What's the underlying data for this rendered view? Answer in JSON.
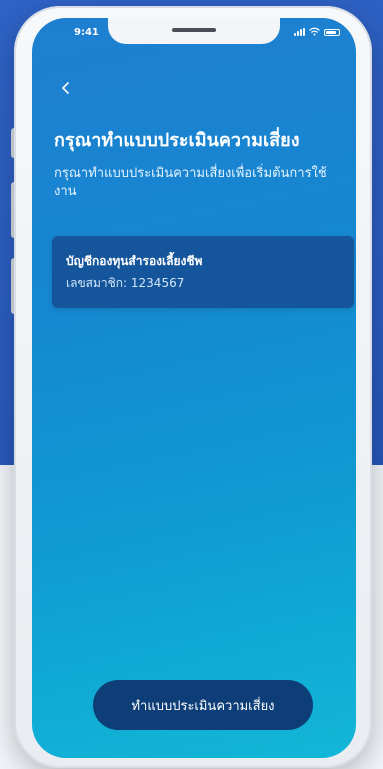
{
  "status_bar": {
    "time": "9:41"
  },
  "header": {
    "back_icon": "chevron-left-icon",
    "title": "กรุณาทำแบบประเมินความเสี่ยง",
    "subtitle": "กรุณาทำแบบประเมินความเสี่ยงเพื่อเริ่มต้นการใช้งาน"
  },
  "account_card": {
    "name": "บัญชีกองทุนสำรองเลี้ยงชีพ",
    "member_number": "เลขสมาชิก: 1234567"
  },
  "cta": {
    "label": "ทำแบบประเมินความเสี่ยง"
  },
  "colors": {
    "screen_gradient_top": "#1e7fd0",
    "screen_gradient_bottom": "#12b7d7",
    "card_background": "#15559b",
    "button_background": "#0d3e78",
    "backdrop_blue": "#2f63c7"
  }
}
